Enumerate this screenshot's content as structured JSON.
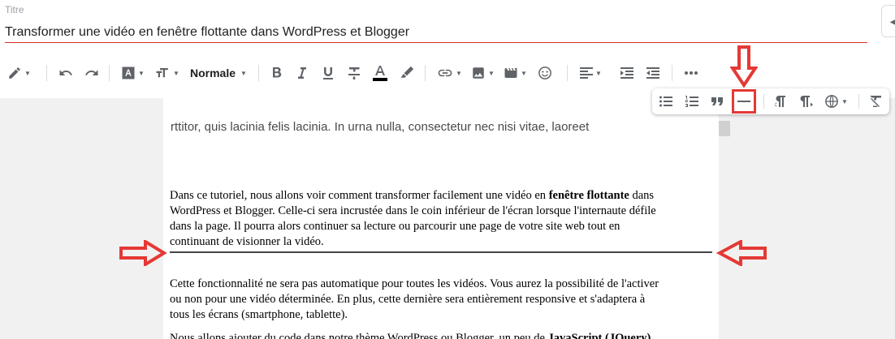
{
  "title": {
    "label": "Titre",
    "value": "Transformer une vidéo en fenêtre flottante dans WordPress et Blogger"
  },
  "toolbar": {
    "paragraph_style": "Normale",
    "icons": [
      "pencil-icon",
      "undo-icon",
      "redo-icon",
      "font-icon",
      "font-size-icon",
      "bold-icon",
      "italic-icon",
      "underline-icon",
      "strikethrough-icon",
      "text-color-icon",
      "highlight-icon",
      "link-icon",
      "image-icon",
      "video-icon",
      "emoji-icon",
      "align-icon",
      "indent-icon",
      "outdent-icon",
      "more-icon"
    ]
  },
  "float_toolbar": {
    "icons": [
      "bulleted-list-icon",
      "numbered-list-icon",
      "quote-icon",
      "horizontal-line-icon",
      "ltr-icon",
      "rtl-icon",
      "language-icon",
      "clear-format-icon"
    ],
    "highlighted": "horizontal-line-icon"
  },
  "editor": {
    "preview_line": "rttitor, quis lacinia felis lacinia. In urna nulla, consectetur nec nisi vitae, laoreet",
    "para1_lines": [
      "Dans ce tutoriel, nous allons voir comment transformer facilement une vidéo en ",
      "fenêtre flottante",
      " dans",
      "WordPress et Blogger. Celle-ci sera incrustée dans le coin inférieur de l'écran lorsque l'internaute défile",
      "dans la page. Il pourra alors continuer sa lecture ou parcourir une page de votre site web tout en",
      "continuant de visionner la vidéo."
    ],
    "para2_lines": [
      "Cette fonctionnalité ne sera pas automatique pour toutes les vidéos. Vous aurez la possibilité de l'activer",
      "ou non pour une vidéo déterminée. En plus, cette dernière sera entièrement responsive et s'adaptera à",
      "tous les écrans (smartphone, tablette)."
    ],
    "para3_partial_a": "Nous allons ajouter du code dans notre thème WordPress ou Blogger, un peu de ",
    "para3_partial_b": "JavaScript (JQuery)"
  },
  "colors": {
    "annotation_red": "#e53935",
    "title_underline": "#d93025",
    "gutter": "#f1f1f1"
  }
}
